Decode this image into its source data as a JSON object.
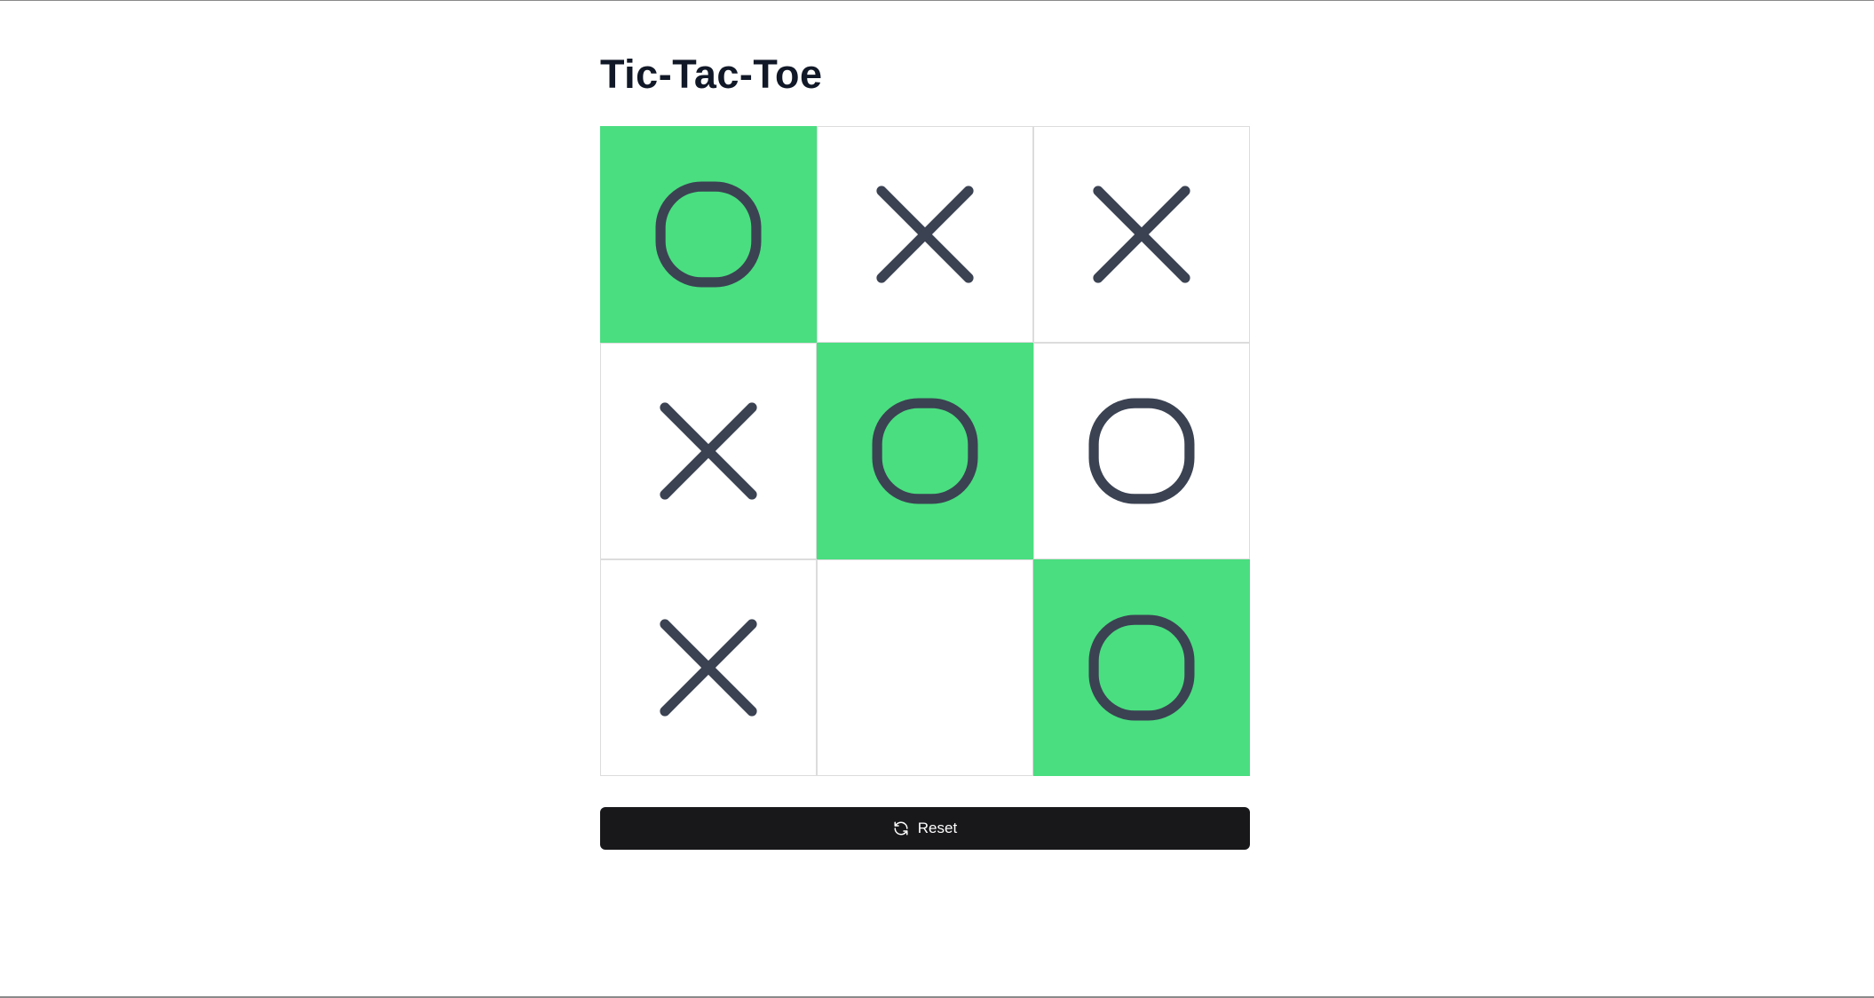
{
  "app": {
    "title": "Tic-Tac-Toe"
  },
  "colors": {
    "win_highlight": "#4ade80",
    "mark": "#3b4252",
    "button_bg": "#18181b",
    "title": "#111827"
  },
  "board": {
    "cells": [
      {
        "mark": "O",
        "win": true
      },
      {
        "mark": "X",
        "win": false
      },
      {
        "mark": "X",
        "win": false
      },
      {
        "mark": "X",
        "win": false
      },
      {
        "mark": "O",
        "win": true
      },
      {
        "mark": "O",
        "win": false
      },
      {
        "mark": "X",
        "win": false
      },
      {
        "mark": "",
        "win": false
      },
      {
        "mark": "O",
        "win": true
      }
    ]
  },
  "controls": {
    "reset_label": "Reset",
    "reset_icon": "refresh-icon"
  }
}
